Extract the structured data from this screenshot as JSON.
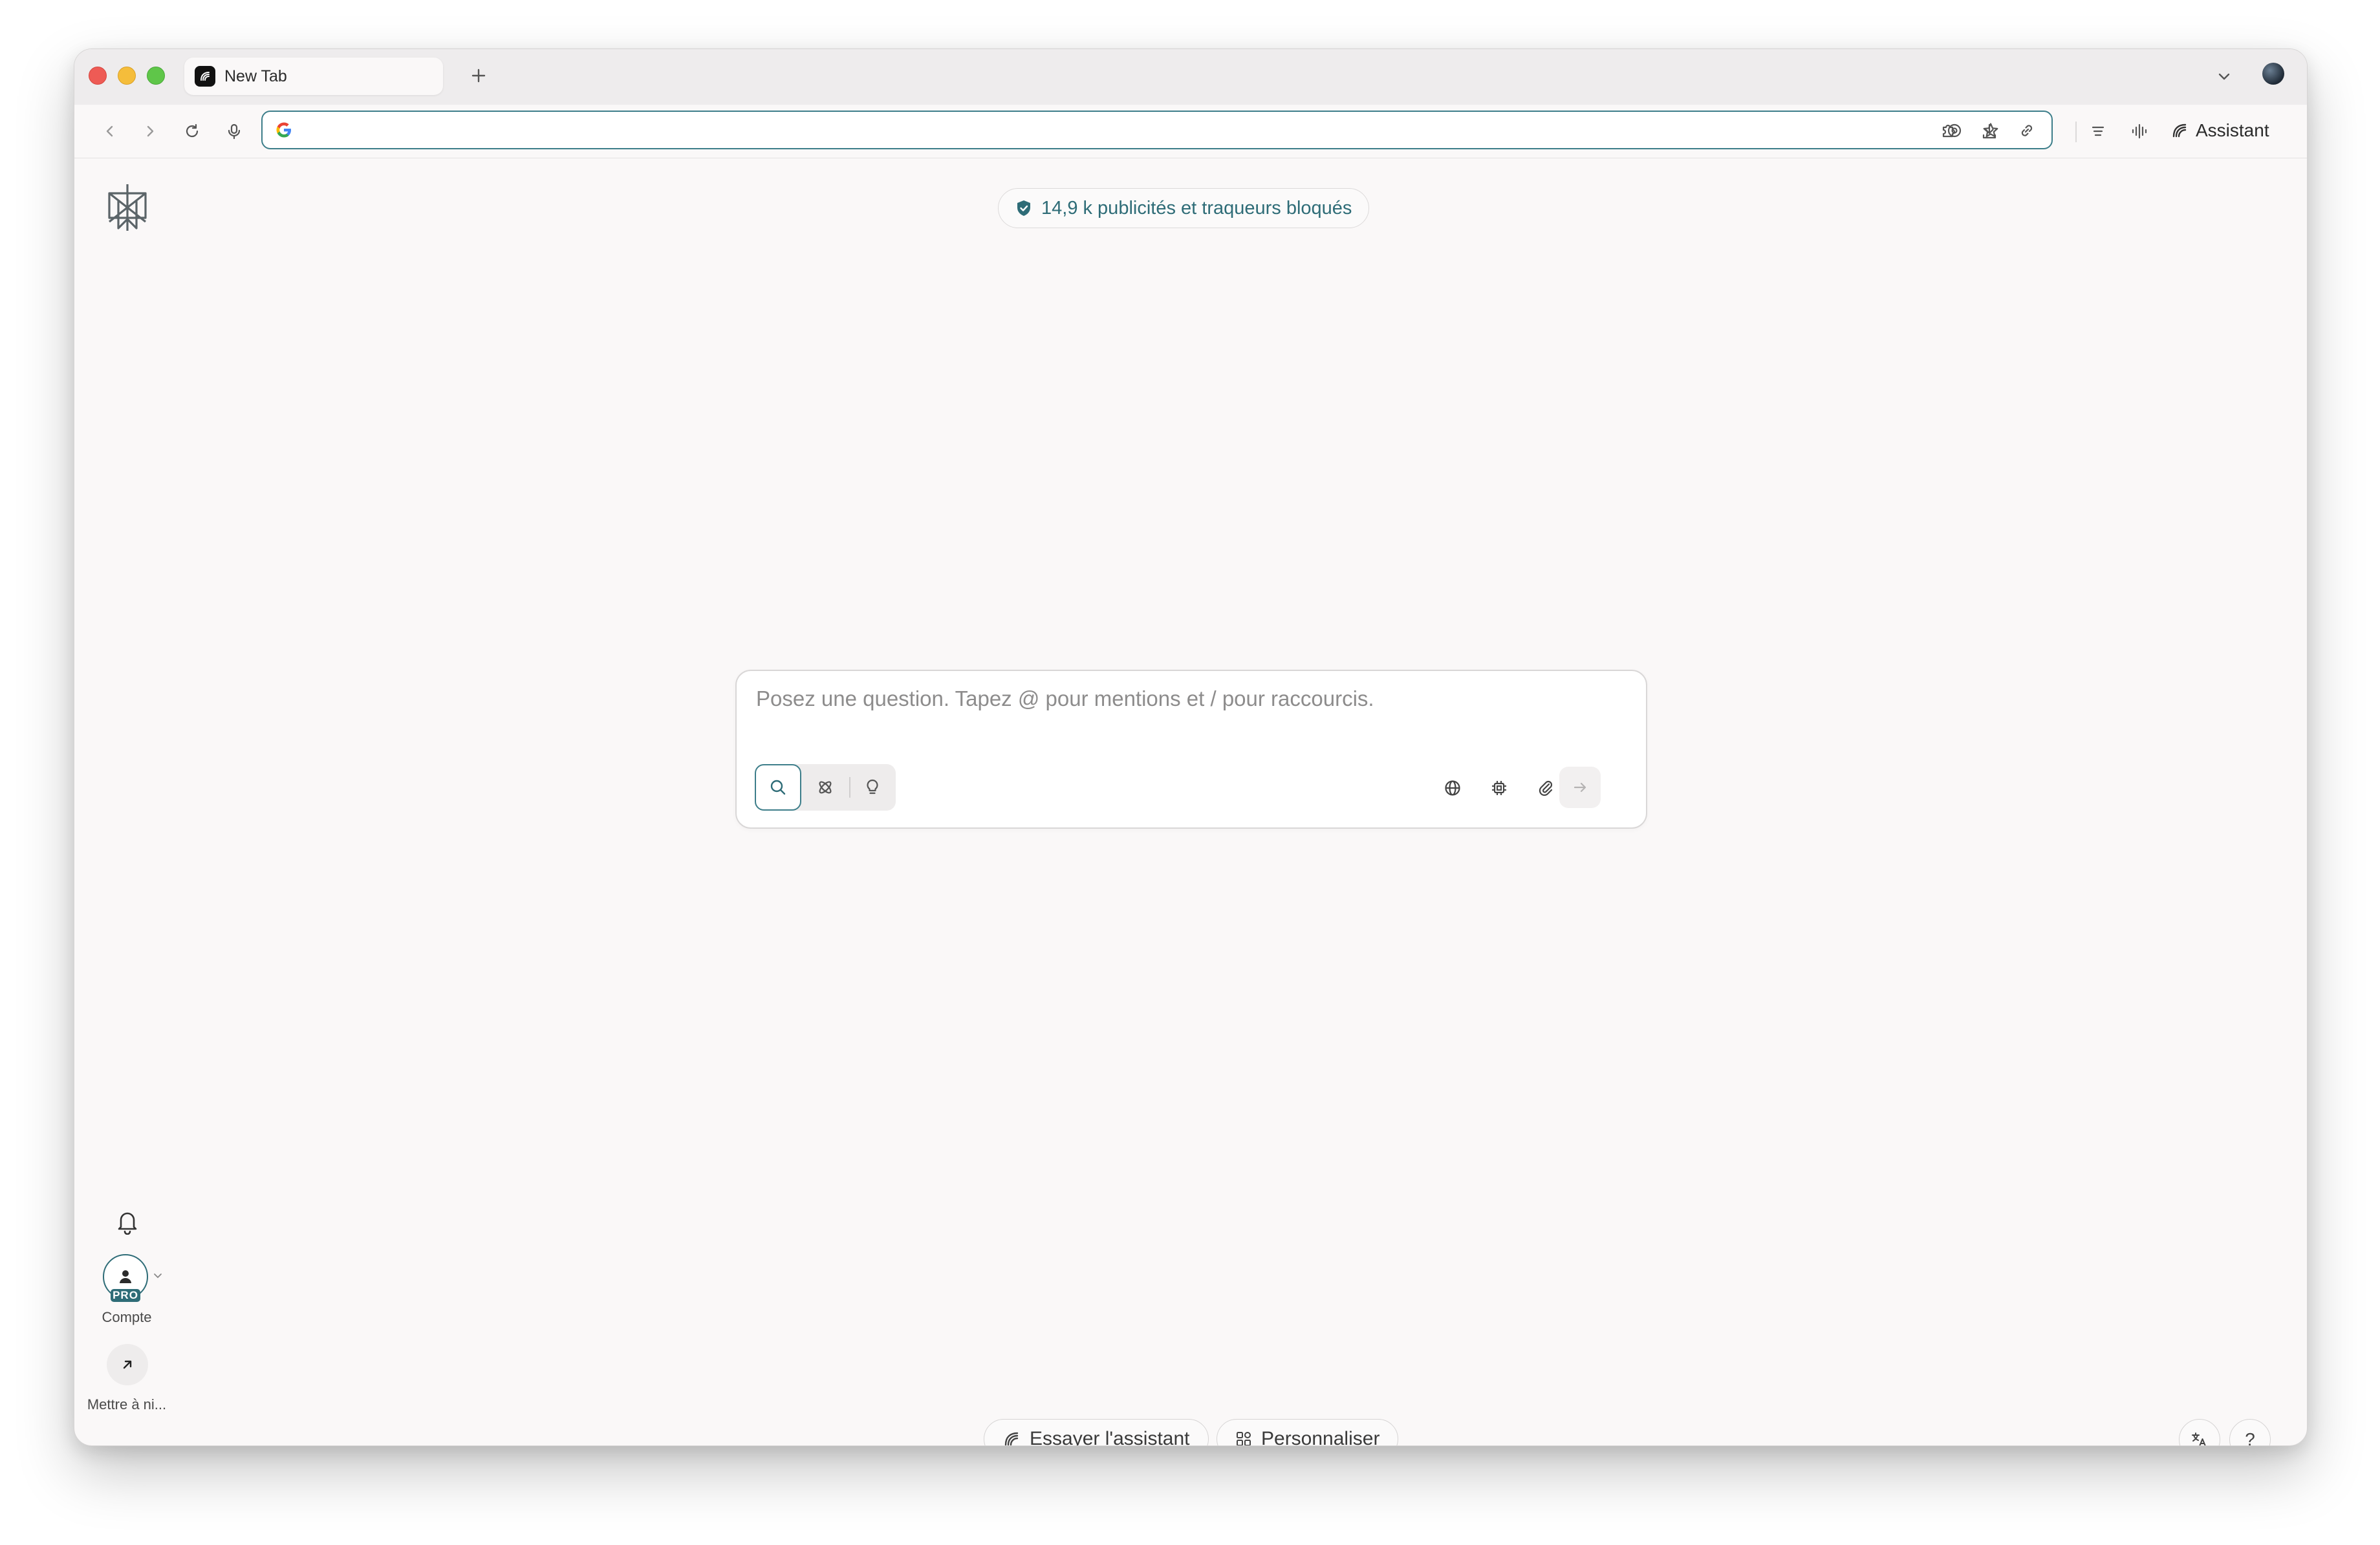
{
  "browser": {
    "tab": {
      "title": "New Tab",
      "icon": "perplexity-favicon-icon"
    },
    "toolbar": {
      "address_value": "",
      "address_icon": "google-g-icon",
      "assistant_label": "Assistant"
    }
  },
  "page": {
    "blocked_text": "14,9 k publicités et traqueurs bloqués",
    "search": {
      "placeholder": "Posez une question. Tapez @ pour mentions et / pour raccourcis.",
      "modes": [
        "search",
        "research",
        "labs"
      ],
      "active_mode": "search"
    },
    "rail": {
      "account_label": "Compte",
      "pro_badge": "PRO",
      "upgrade_label": "Mettre à ni..."
    },
    "bottom": {
      "try_assistant": "Essayer l'assistant",
      "customize": "Personnaliser",
      "help": "?"
    }
  },
  "colors": {
    "accent": "#2e6c77",
    "address_border": "#3d7e8a",
    "background": "#faf8f8"
  }
}
